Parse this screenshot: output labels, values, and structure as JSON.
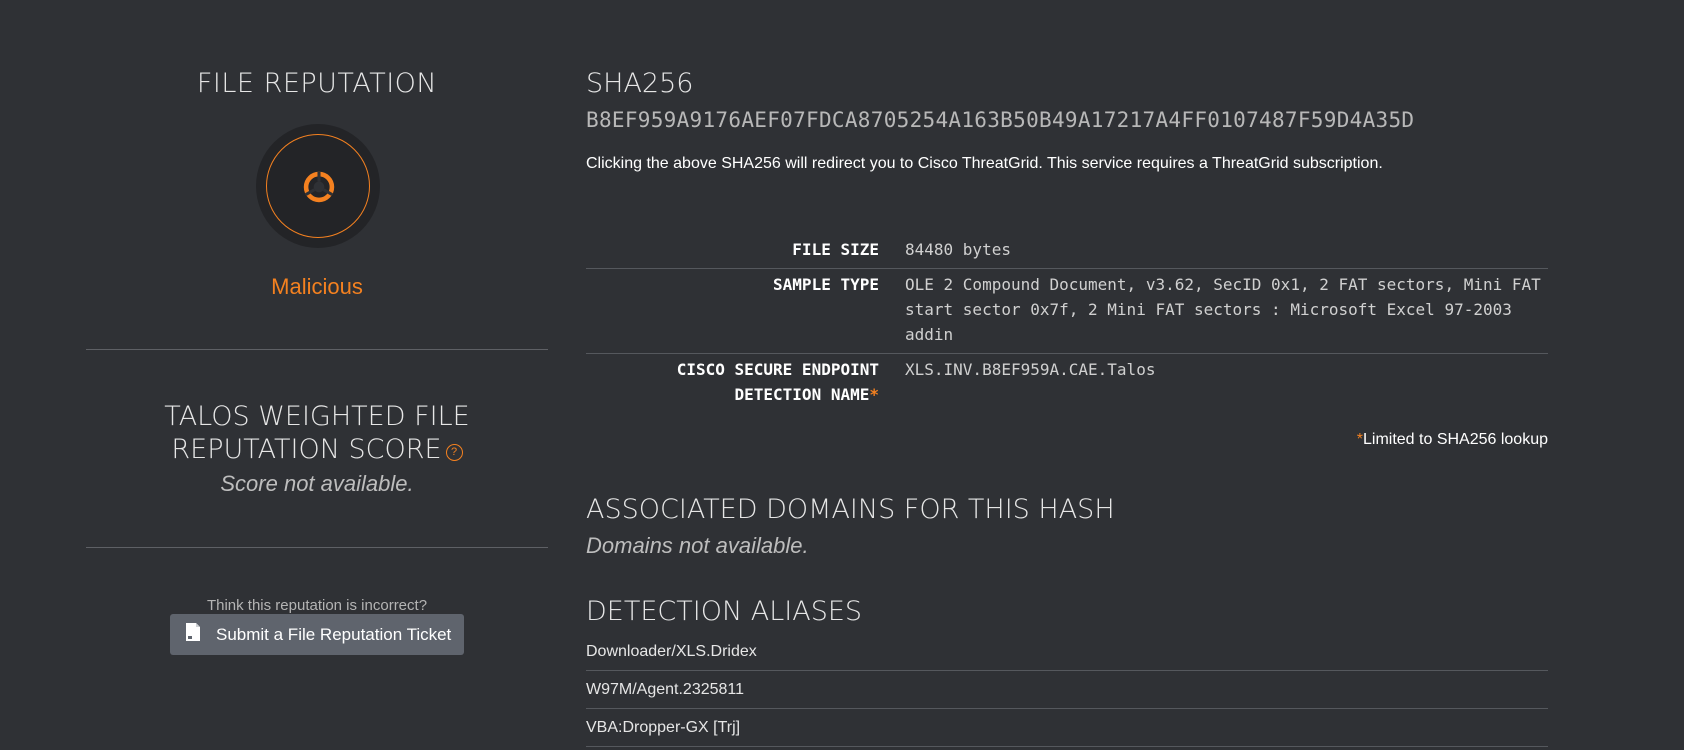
{
  "left": {
    "title": "FILE REPUTATION",
    "icon": "biohazard-icon",
    "verdict": "Malicious",
    "score_title": "TALOS WEIGHTED FILE REPUTATION SCORE",
    "score_help_glyph": "?",
    "score_value": "Score not available.",
    "think_text": "Think this reputation is incorrect?",
    "ticket_button": "Submit a File Reputation Ticket"
  },
  "right": {
    "sha_label": "SHA256",
    "sha_value": "B8EF959A9176AEF07FDCA8705254A163B50B49A17217A4FF0107487F59D4A35D",
    "sha_note": "Clicking the above SHA256 will redirect you to Cisco ThreatGrid. This service requires a ThreatGrid subscription.",
    "rows": [
      {
        "key": "FILE SIZE",
        "value": "84480 bytes"
      },
      {
        "key": "SAMPLE TYPE",
        "value": "OLE 2 Compound Document, v3.62, SecID 0x1, 2 FAT sectors, Mini FAT start sector 0x7f, 2 Mini FAT sectors : Microsoft Excel 97-2003 addin"
      },
      {
        "key": "CISCO SECURE ENDPOINT DETECTION NAME",
        "value": "XLS.INV.B8EF959A.CAE.Talos"
      }
    ],
    "asterisk": "*",
    "limited_note": "Limited to SHA256 lookup",
    "assoc_title": "ASSOCIATED DOMAINS FOR THIS HASH",
    "assoc_value": "Domains not available.",
    "alias_title": "DETECTION ALIASES",
    "aliases": [
      "Downloader/XLS.Dridex",
      "W97M/Agent.2325811",
      "VBA:Dropper-GX [Trj]"
    ]
  },
  "colors": {
    "background": "#2f3135",
    "accent": "#f48120",
    "button": "#5f646d"
  }
}
